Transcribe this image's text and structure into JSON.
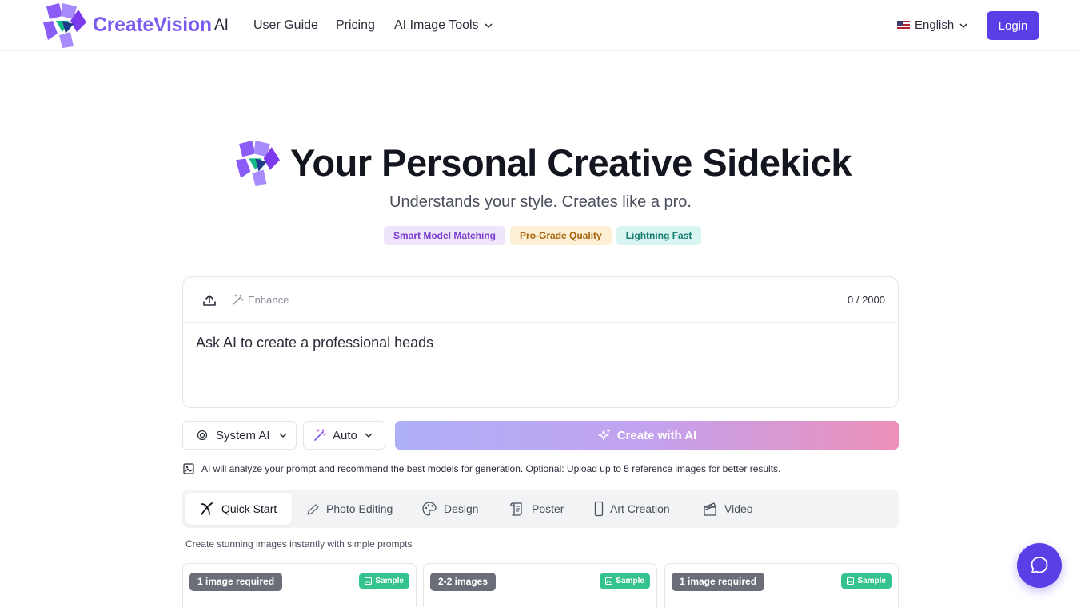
{
  "header": {
    "brand": "CreateVision",
    "brand_suffix": "AI",
    "nav": {
      "user_guide": "User Guide",
      "pricing": "Pricing",
      "tools": "AI Image Tools"
    },
    "language": "English",
    "login_label": "Login"
  },
  "hero": {
    "title": "Your Personal Creative Sidekick",
    "subtitle": "Understands your style. Creates like a pro.",
    "badges": [
      "Smart Model Matching",
      "Pro-Grade Quality",
      "Lightning Fast"
    ]
  },
  "prompt": {
    "enhance_label": "Enhance",
    "counter": "0 / 2000",
    "text": "Ask AI to create a professional heads"
  },
  "controls": {
    "model_select": "System AI",
    "ratio_select": "Auto",
    "create_label": "Create with AI",
    "info": "AI will analyze your prompt and recommend the best models for generation. Optional: Upload up to 5 reference images for better results."
  },
  "tabs": [
    {
      "label": "Quick Start",
      "icon": "quick-start-icon"
    },
    {
      "label": "Photo Editing",
      "icon": "pencil-icon"
    },
    {
      "label": "Design",
      "icon": "palette-icon"
    },
    {
      "label": "Poster",
      "icon": "scroll-icon"
    },
    {
      "label": "Art Creation",
      "icon": "phone-icon"
    },
    {
      "label": "Video",
      "icon": "clapper-icon"
    }
  ],
  "tab_caption": "Create stunning images instantly with simple prompts",
  "cards": [
    {
      "requirement": "1 image required",
      "sample": "Sample"
    },
    {
      "requirement": "2-2 images",
      "sample": "Sample"
    },
    {
      "requirement": "1 image required",
      "sample": "Sample"
    }
  ],
  "colors": {
    "accent": "#5b3fe6",
    "brand": "#7c5cf0",
    "sample_badge": "#34c38f"
  }
}
